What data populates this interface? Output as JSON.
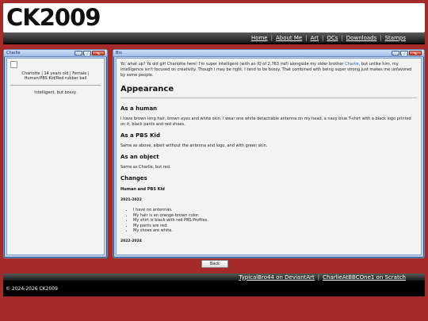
{
  "site": {
    "logo": "CK2009"
  },
  "nav": {
    "items": [
      {
        "label": "Home"
      },
      {
        "label": "About Me"
      },
      {
        "label": "Art"
      },
      {
        "label": "OCs"
      },
      {
        "label": "Downloads"
      },
      {
        "label": "Stamps"
      }
    ],
    "separator": "|"
  },
  "left_window": {
    "title": "Charlie",
    "info": "Charlotte | 14 years old | Female | Human/PBS Kid/Red rubber ball",
    "tagline": "Intelligent, but bossy."
  },
  "main_window": {
    "title": "Bio",
    "intro_before": "Yo, what up? Ya old girl Charlotte here! I'm super intelligent (with an IQ of 2,763 /ref) alongside my older brother ",
    "intro_link": "Charlie",
    "intro_after": ", but unlike him, my intelligence isn't focused on creativity. Though I may be right, I tend to be bossy. That combined with being super strong just makes me unfavored by some people.",
    "appearance_heading": "Appearance",
    "human_heading": "As a human",
    "human_text": "I have brown long hair, brown eyes and white skin. I wear one white detachable antenna on my head, a navy blue T-shirt with a black logo printed on it, black pants and red shoes.",
    "pbs_heading": "As a PBS Kid",
    "pbs_text": "Same as above, albeit without the antenna and logo, and with green skin.",
    "object_heading": "As an object",
    "object_text": "Same as Charlie, but red.",
    "changes_heading": "Changes",
    "changes_sub": "Human and PBS Kid",
    "period1": "2021-2022",
    "changes_list": [
      "I have no antennas.",
      "My hair is an orange-brown color.",
      "My shirt is black with red PBS Profiles.",
      "My pants are red.",
      "My shoes are white."
    ],
    "period2": "2022-2024"
  },
  "back_button": "Back",
  "footer_links": [
    {
      "label": "TypicalBro44 on DeviantArt"
    },
    {
      "label": "CharlieAtBBCOne1 on Scratch"
    }
  ],
  "copyright": "© 2024-2026 CK2009",
  "colors": {
    "background": "#a52a2a",
    "link": "#1a5fd6"
  }
}
